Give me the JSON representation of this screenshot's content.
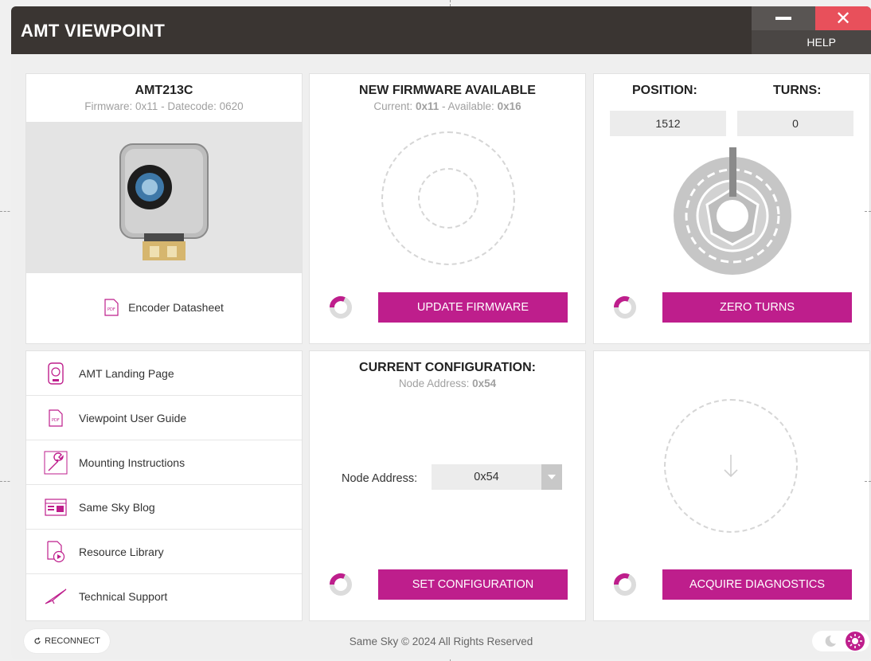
{
  "window": {
    "title": "AMT VIEWPOINT",
    "help_label": "HELP",
    "close_glyph": "✕"
  },
  "device": {
    "model": "AMT213C",
    "fw_prefix": "Firmware:",
    "fw_value": "0x11",
    "dc_prefix": "- Datecode:",
    "dc_value": "0620",
    "datasheet_label": "Encoder Datasheet"
  },
  "firmware": {
    "title": "NEW FIRMWARE AVAILABLE",
    "current_prefix": "Current:",
    "current_value": "0x11",
    "available_prefix": "- Available:",
    "available_value": "0x16",
    "button_label": "UPDATE FIRMWARE"
  },
  "position": {
    "position_label": "POSITION:",
    "turns_label": "TURNS:",
    "position_value": "1512",
    "turns_value": "0",
    "button_label": "ZERO TURNS"
  },
  "links": [
    {
      "label": "AMT Landing Page",
      "icon": "encoder-page-icon"
    },
    {
      "label": "Viewpoint User Guide",
      "icon": "pdf-icon"
    },
    {
      "label": "Mounting Instructions",
      "icon": "wrench-icon"
    },
    {
      "label": "Same Sky Blog",
      "icon": "blog-icon"
    },
    {
      "label": "Resource Library",
      "icon": "video-document-icon"
    },
    {
      "label": "Technical Support",
      "icon": "paper-plane-icon"
    }
  ],
  "configuration": {
    "title": "CURRENT CONFIGURATION:",
    "node_prefix": "Node Address:",
    "node_value": "0x54",
    "select_label": "Node Address:",
    "select_value": "0x54",
    "button_label": "SET CONFIGURATION"
  },
  "diagnostics": {
    "button_label": "ACQUIRE DIAGNOSTICS"
  },
  "footer": {
    "reconnect_label": "RECONNECT",
    "copyright": "Same Sky © 2024 All Rights Reserved"
  },
  "colors": {
    "accent": "#be1e8c",
    "titlebar": "#3a3532",
    "close": "#e8505b"
  }
}
